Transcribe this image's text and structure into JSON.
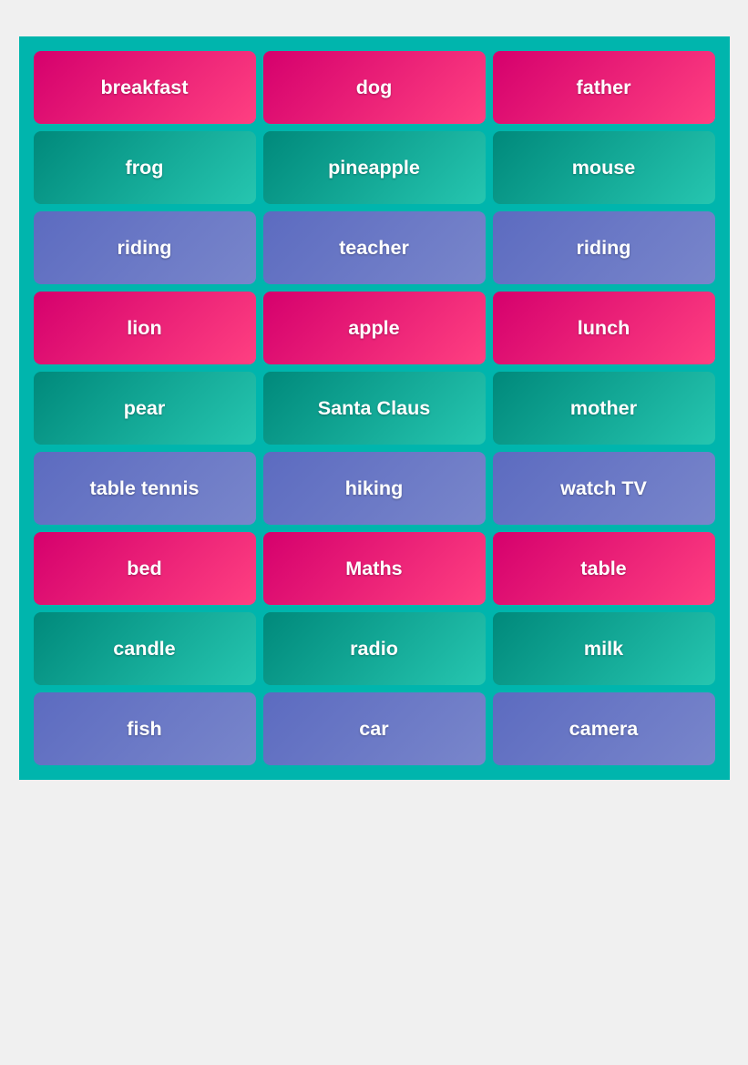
{
  "cards": [
    {
      "word": "breakfast",
      "color": "pink"
    },
    {
      "word": "dog",
      "color": "pink"
    },
    {
      "word": "father",
      "color": "pink"
    },
    {
      "word": "frog",
      "color": "teal"
    },
    {
      "word": "pineapple",
      "color": "teal"
    },
    {
      "word": "mouse",
      "color": "teal"
    },
    {
      "word": "riding",
      "color": "purple"
    },
    {
      "word": "teacher",
      "color": "purple"
    },
    {
      "word": "riding",
      "color": "purple"
    },
    {
      "word": "lion",
      "color": "pink"
    },
    {
      "word": "apple",
      "color": "pink"
    },
    {
      "word": "lunch",
      "color": "pink"
    },
    {
      "word": "pear",
      "color": "teal"
    },
    {
      "word": "Santa Claus",
      "color": "teal"
    },
    {
      "word": "mother",
      "color": "teal"
    },
    {
      "word": "table tennis",
      "color": "purple"
    },
    {
      "word": "hiking",
      "color": "purple"
    },
    {
      "word": "watch TV",
      "color": "purple"
    },
    {
      "word": "bed",
      "color": "pink"
    },
    {
      "word": "Maths",
      "color": "pink"
    },
    {
      "word": "table",
      "color": "pink"
    },
    {
      "word": "candle",
      "color": "teal"
    },
    {
      "word": "radio",
      "color": "teal"
    },
    {
      "word": "milk",
      "color": "teal"
    },
    {
      "word": "fish",
      "color": "purple"
    },
    {
      "word": "car",
      "color": "purple"
    },
    {
      "word": "camera",
      "color": "purple"
    }
  ]
}
